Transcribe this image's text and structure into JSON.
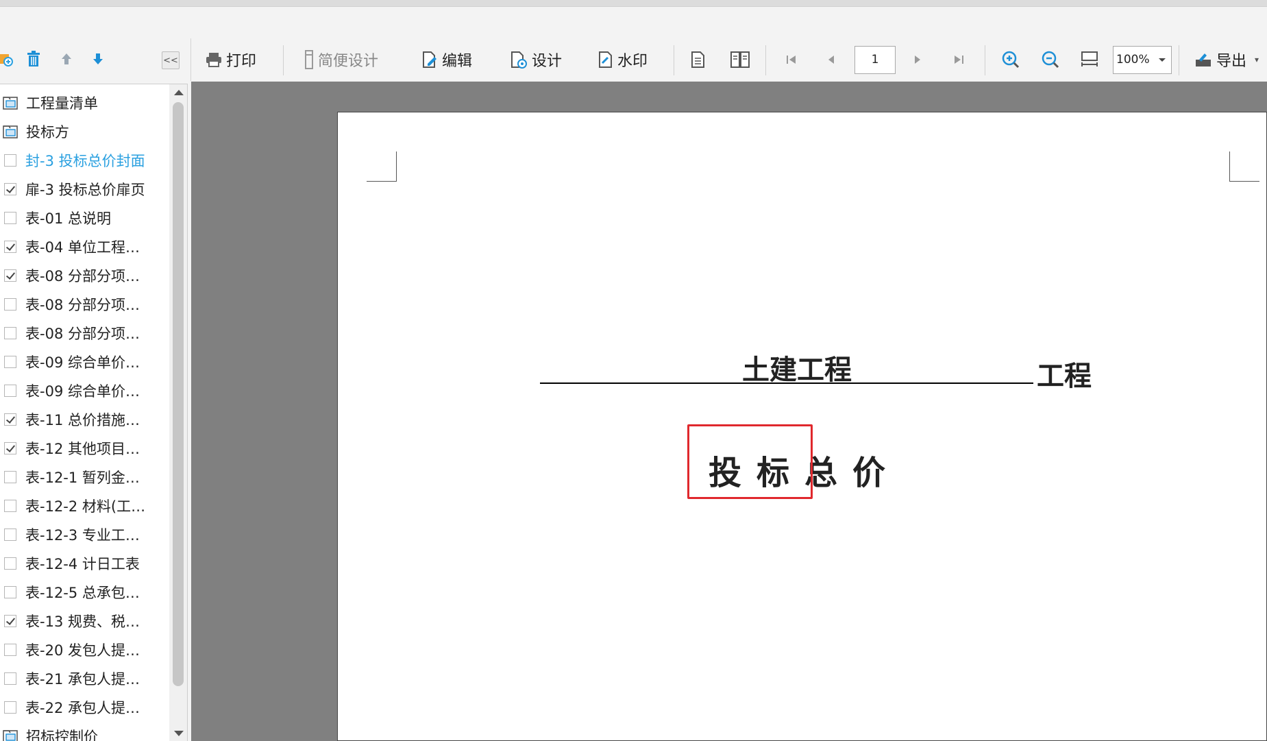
{
  "left_toolbar": {
    "icons": [
      "add-icon",
      "delete-icon",
      "move-up-icon",
      "move-down-icon"
    ],
    "collapse_label": "<<"
  },
  "tree": {
    "items": [
      {
        "type": "folder",
        "label": "工程量清单"
      },
      {
        "type": "folder",
        "label": "投标方"
      },
      {
        "type": "check",
        "checked": false,
        "selected": true,
        "label": "封-3 投标总价封面"
      },
      {
        "type": "check",
        "checked": true,
        "label": "扉-3 投标总价扉页"
      },
      {
        "type": "check",
        "checked": false,
        "label": "表-01 总说明"
      },
      {
        "type": "check",
        "checked": true,
        "label": "表-04 单位工程…"
      },
      {
        "type": "check",
        "checked": true,
        "label": "表-08 分部分项…"
      },
      {
        "type": "check",
        "checked": false,
        "label": "表-08 分部分项…"
      },
      {
        "type": "check",
        "checked": false,
        "label": "表-08 分部分项…"
      },
      {
        "type": "check",
        "checked": false,
        "label": "表-09 综合单价…"
      },
      {
        "type": "check",
        "checked": false,
        "label": "表-09 综合单价…"
      },
      {
        "type": "check",
        "checked": true,
        "label": "表-11 总价措施…"
      },
      {
        "type": "check",
        "checked": true,
        "label": "表-12 其他项目…"
      },
      {
        "type": "check",
        "checked": false,
        "label": "表-12-1 暂列金…"
      },
      {
        "type": "check",
        "checked": false,
        "label": "表-12-2 材料(工…"
      },
      {
        "type": "check",
        "checked": false,
        "label": "表-12-3 专业工…"
      },
      {
        "type": "check",
        "checked": false,
        "label": "表-12-4 计日工表"
      },
      {
        "type": "check",
        "checked": false,
        "label": "表-12-5 总承包…"
      },
      {
        "type": "check",
        "checked": true,
        "label": "表-13 规费、税…"
      },
      {
        "type": "check",
        "checked": false,
        "label": "表-20 发包人提…"
      },
      {
        "type": "check",
        "checked": false,
        "label": "表-21 承包人提…"
      },
      {
        "type": "check",
        "checked": false,
        "label": "表-22 承包人提…"
      },
      {
        "type": "folder",
        "label": "招标控制价"
      }
    ]
  },
  "toolbar": {
    "print": "打印",
    "simple_design": "简便设计",
    "edit": "编辑",
    "design": "设计",
    "watermark": "水印",
    "export": "导出"
  },
  "pager": {
    "current_page": "1"
  },
  "zoom": {
    "value": "100%"
  },
  "document": {
    "project_name": "土建工程",
    "project_suffix": "工程",
    "title": "投标总价"
  },
  "colors": {
    "selected_item": "#2aa0e0",
    "highlight_box": "#e0282d"
  }
}
